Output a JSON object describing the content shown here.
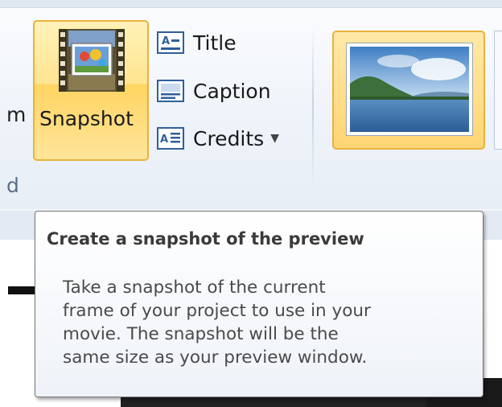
{
  "ribbon": {
    "partial_left_label": "m",
    "partial_group_label": "d",
    "snapshot": {
      "label": "Snapshot",
      "icon": "filmstrip-snapshot-icon"
    },
    "small_buttons": [
      {
        "label": "Title",
        "icon": "title-icon",
        "has_dropdown": false
      },
      {
        "label": "Caption",
        "icon": "caption-icon",
        "has_dropdown": false
      },
      {
        "label": "Credits",
        "icon": "credits-icon",
        "has_dropdown": true
      }
    ],
    "theme_gallery": {
      "selected_thumbnail": "landscape-lake-thumbnail"
    }
  },
  "tooltip": {
    "title": "Create a snapshot of the preview",
    "body_lines": [
      "Take a snapshot of the current",
      "frame of your project to use in your",
      "movie.  The snapshot will be the",
      "same size as your preview window."
    ]
  },
  "colors": {
    "highlight_border": "#e9b23c",
    "highlight_fill": "#ffe490",
    "ribbon_bg": "#eef3f9",
    "tooltip_border": "#767676",
    "tooltip_title": "#3a3a3a",
    "tooltip_text": "#4a4a4a"
  }
}
